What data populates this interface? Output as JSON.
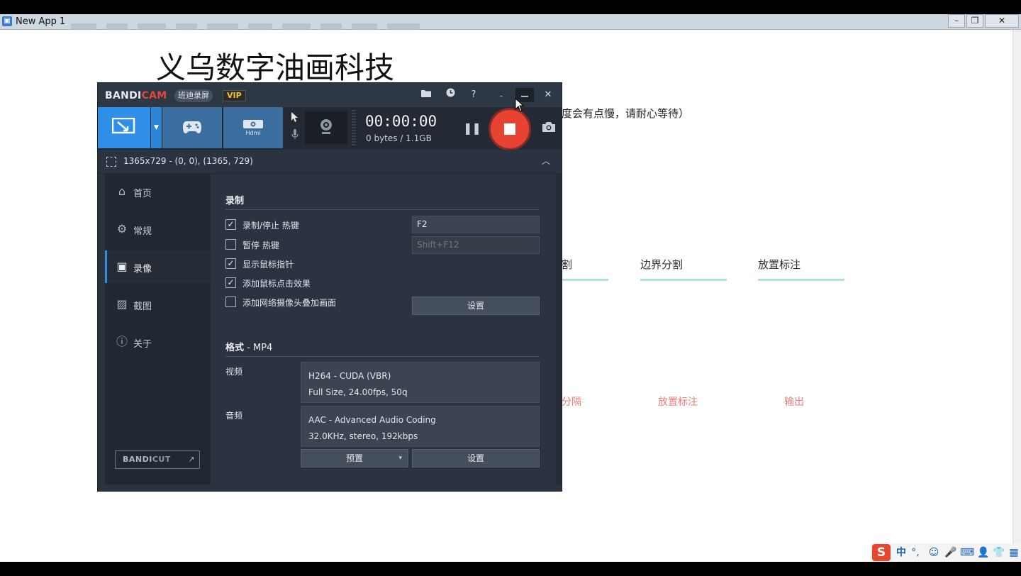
{
  "host_window": {
    "title": "New App 1",
    "min_glyph": "–",
    "max_glyph": "❐",
    "close_glyph": "✕"
  },
  "host_page": {
    "heading": "义乌数字油画科技",
    "notice": "度会有点慢，请耐心等待）",
    "tabs": [
      "割",
      "边界分割",
      "放置标注"
    ],
    "steps": [
      "分隔",
      "放置标注",
      "输出"
    ],
    "tab_underline_color": "#a8e0e6",
    "step_color": "#f07a7a"
  },
  "bandicam": {
    "logo_main": "BANDI",
    "logo_accent": "CAM",
    "cn_badge": "班迪录屏",
    "vip": "VIP",
    "title_icons": [
      "folder-icon",
      "clock-icon",
      "help-icon",
      "minimize-icon",
      "close-icon"
    ],
    "help_glyph": "?",
    "close_glyph": "✕",
    "modes": [
      "screen-record-mode",
      "game-record-mode",
      "hdmi-record-mode"
    ],
    "hdmi_label": "Hdmi",
    "timer": "00:00:00",
    "size": "0 bytes / 1.1GB",
    "pause_glyph": "❚❚",
    "camera_glyph": "📷",
    "region": "1365x729 - (0, 0), (1365, 729)",
    "collapse_glyph": "︿",
    "accent_color": "#2f8fe6",
    "record_color": "#e64333",
    "sidebar": {
      "items": [
        {
          "label": "首页",
          "icon": "home-icon",
          "glyph": "⌂",
          "active": false
        },
        {
          "label": "常规",
          "icon": "gear-icon",
          "glyph": "⚙",
          "active": false
        },
        {
          "label": "录像",
          "icon": "video-settings-icon",
          "glyph": "▣",
          "active": true
        },
        {
          "label": "截图",
          "icon": "screenshot-icon",
          "glyph": "▨",
          "active": false
        },
        {
          "label": "关于",
          "icon": "info-icon",
          "glyph": "ⓘ",
          "active": false
        }
      ],
      "bandicut_main": "BANDI",
      "bandicut_accent": "CUT",
      "bandicut_arrow": "↗"
    },
    "record_section": {
      "title": "录制",
      "options": [
        {
          "label": "录制/停止 热键",
          "checked": true,
          "mark": "✓"
        },
        {
          "label": "暂停 热键",
          "checked": false,
          "mark": ""
        },
        {
          "label": "显示鼠标指针",
          "checked": true,
          "mark": "✓"
        },
        {
          "label": "添加鼠标点击效果",
          "checked": true,
          "mark": "✓"
        },
        {
          "label": "添加网络摄像头叠加画面",
          "checked": false,
          "mark": ""
        }
      ],
      "hotkey_record": "F2",
      "hotkey_pause": "Shift+F12",
      "webcam_settings": "设置"
    },
    "format_section": {
      "title": "格式",
      "format": " - MP4",
      "video_label": "视频",
      "video_codec": "H264 - CUDA (VBR)",
      "video_detail": "Full Size, 24.00fps, 50q",
      "audio_label": "音频",
      "audio_codec": "AAC - Advanced Audio Coding",
      "audio_detail": "32.0KHz, stereo, 192kbps",
      "preset_label": "预置",
      "preset_caret": "▾",
      "settings_label": "设置"
    }
  },
  "ime": {
    "logo": "S",
    "mode": "中",
    "punct": "°,",
    "emoji": "☺",
    "mic": "🎤",
    "keyboard": "⌨",
    "user": "👤",
    "skin": "👕",
    "grid": "▦"
  }
}
